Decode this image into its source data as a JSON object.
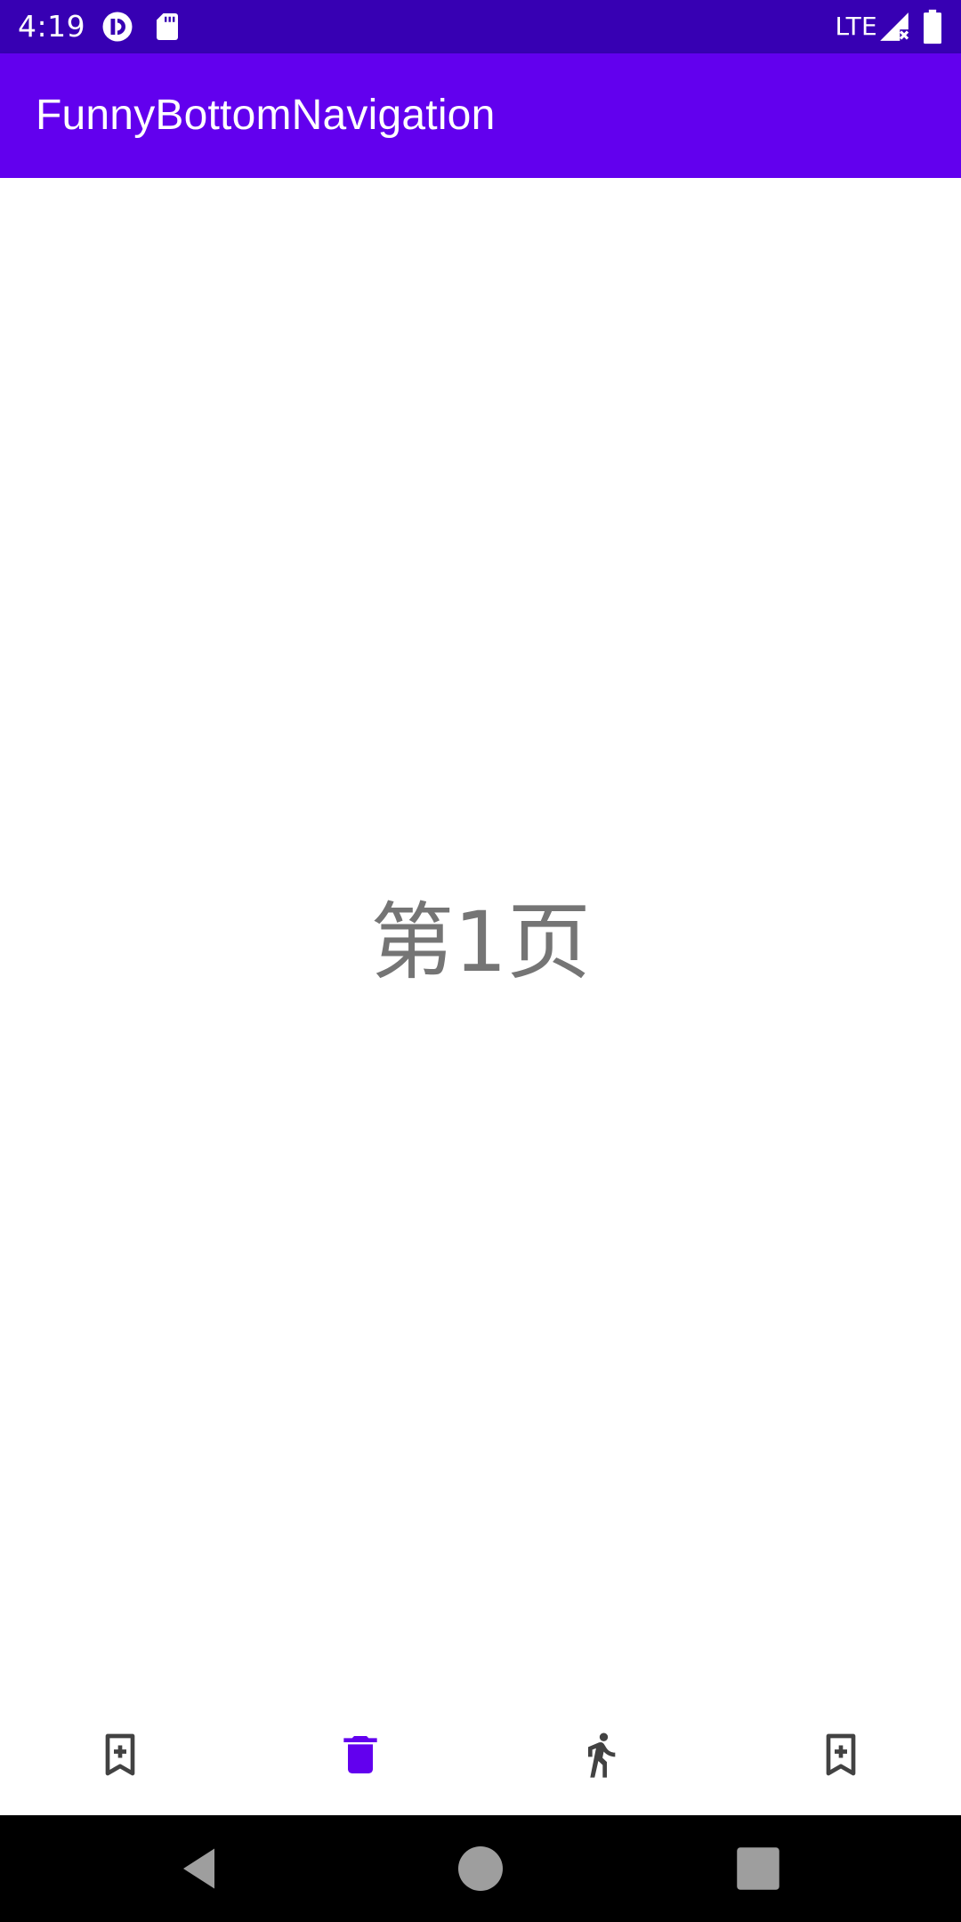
{
  "status_bar": {
    "time": "4:19",
    "network": "LTE",
    "icons": [
      "pocket-casts-icon",
      "sd-card-icon",
      "signal-no-data-icon",
      "battery-icon"
    ],
    "background_color": "#3700B3"
  },
  "app_bar": {
    "title": "FunnyBottomNavigation",
    "background_color": "#6200EE"
  },
  "main": {
    "page_label": "第1页",
    "text_color": "#757575"
  },
  "bottom_nav": {
    "selected_index": 1,
    "active_color": "#6200EE",
    "inactive_color": "#424242",
    "items": [
      {
        "icon": "bookmark-add-icon"
      },
      {
        "icon": "delete-icon"
      },
      {
        "icon": "walk-icon"
      },
      {
        "icon": "bookmark-add-icon"
      }
    ]
  },
  "system_nav": {
    "buttons": [
      "back-icon",
      "home-icon",
      "recents-icon"
    ],
    "background_color": "#000000",
    "button_color": "#9E9E9E"
  }
}
